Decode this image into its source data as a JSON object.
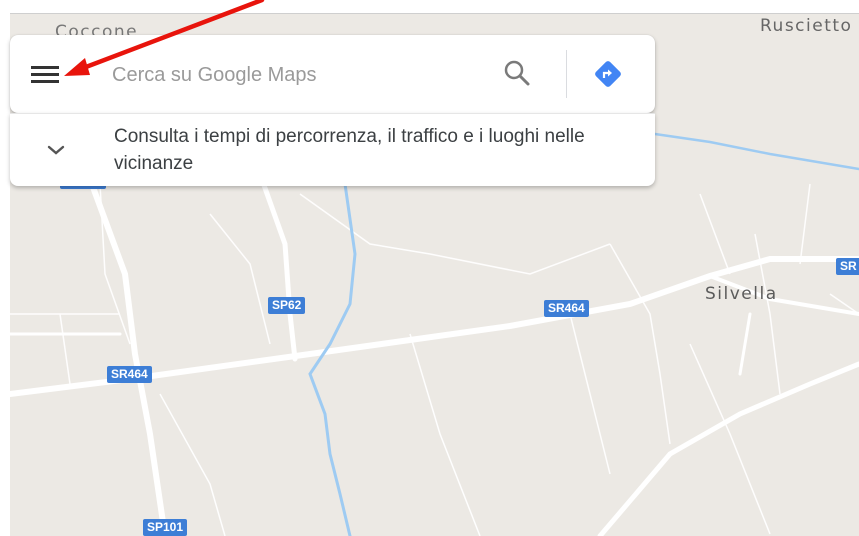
{
  "map": {
    "place_labels": {
      "top_left": "Coccone",
      "top_right": "Ruscietto",
      "silvella": "Silvella"
    },
    "road_shields": {
      "sp62": "SP62",
      "sr464_center": "SR464",
      "sr464_left": "SR464",
      "sp101": "SP101",
      "sr_right": "SR"
    },
    "colors": {
      "land": "#ece9e4",
      "road": "#ffffff",
      "water": "#9ecbf2",
      "shield": "#3d7ed6"
    }
  },
  "searchbox": {
    "menu_icon": "hamburger-menu-icon",
    "placeholder": "Cerca su Google Maps",
    "value": "",
    "search_icon": "search-icon",
    "directions_icon": "directions-icon",
    "directions_color": "#4285f4"
  },
  "info_panel": {
    "chevron_icon": "chevron-down-icon",
    "text": "Consulta i tempi di percorrenza, il traffico e i luoghi nelle vicinanze"
  },
  "annotation": {
    "arrow_color": "#e8140c"
  }
}
